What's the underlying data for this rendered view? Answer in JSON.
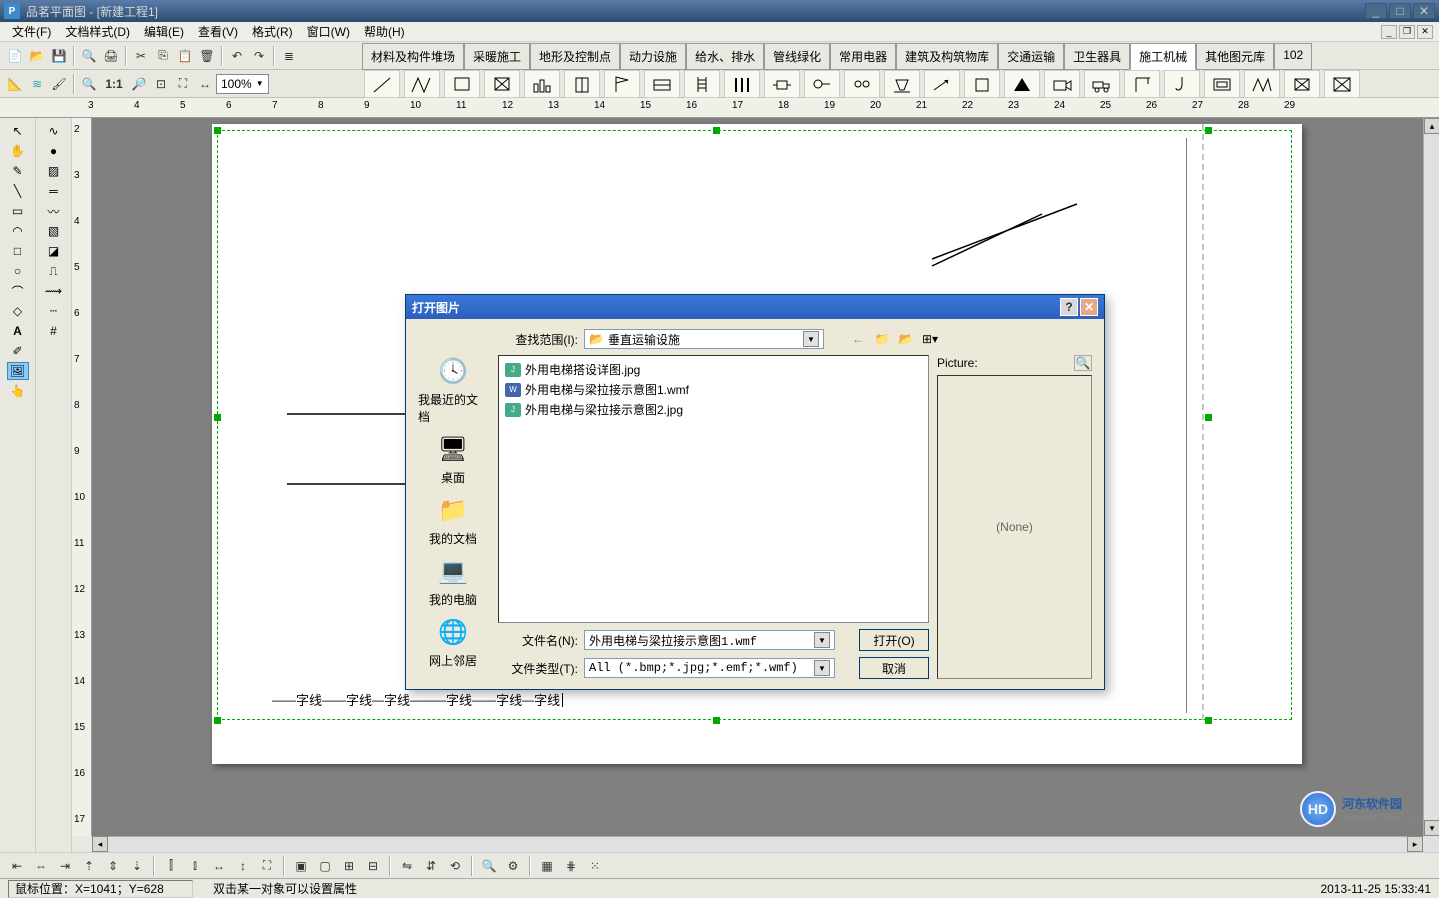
{
  "titlebar": {
    "app_icon_text": "P",
    "title": "品茗平面图 - [新建工程1]"
  },
  "menubar": {
    "items": [
      "文件(F)",
      "文档样式(D)",
      "编辑(E)",
      "查看(V)",
      "格式(R)",
      "窗口(W)",
      "帮助(H)"
    ]
  },
  "zoom": {
    "percent": "100%",
    "label_11": "1:1"
  },
  "tabs": {
    "items": [
      "材料及构件堆场",
      "采暖施工",
      "地形及控制点",
      "动力设施",
      "给水、排水",
      "管线绿化",
      "常用电器",
      "建筑及构筑物库",
      "交通运输",
      "卫生器具",
      "施工机械",
      "其他图元库",
      "102"
    ],
    "active_index": 10
  },
  "ruler_h": {
    "ticks": [
      3,
      4,
      5,
      6,
      7,
      8,
      9,
      10,
      11,
      12,
      13,
      14,
      15,
      16,
      17,
      18,
      19,
      20,
      21,
      22,
      23,
      24,
      25,
      26,
      27,
      28,
      29
    ]
  },
  "ruler_v": {
    "ticks": [
      2,
      3,
      4,
      5,
      6,
      7,
      8,
      9,
      10,
      11,
      12,
      13,
      14,
      15,
      16,
      17
    ]
  },
  "canvas_text": {
    "zixian": "字线"
  },
  "dialog": {
    "title": "打开图片",
    "lookIn_label": "查找范围(I):",
    "lookIn_value": "垂直运输设施",
    "sidebar": [
      "我最近的文档",
      "桌面",
      "我的文档",
      "我的电脑",
      "网上邻居"
    ],
    "files": [
      {
        "name": "外用电梯搭设详图.jpg",
        "ext": "jpg"
      },
      {
        "name": "外用电梯与梁拉接示意图1.wmf",
        "ext": "wmf"
      },
      {
        "name": "外用电梯与梁拉接示意图2.jpg",
        "ext": "jpg"
      }
    ],
    "filename_label": "文件名(N):",
    "filename_value": "外用电梯与梁拉接示意图1.wmf",
    "filetype_label": "文件类型(T):",
    "filetype_value": "All (*.bmp;*.jpg;*.emf;*.wmf)",
    "preview_label": "Picture:",
    "preview_none": "(None)",
    "btn_open": "打开(O)",
    "btn_cancel": "取消"
  },
  "status": {
    "mouse": "鼠标位置：X=1041；Y=628",
    "hint": "双击某一对象可以设置属性",
    "datetime": "2013-11-25  15:33:41"
  },
  "watermark": {
    "circle": "HD",
    "name": "河东软件园",
    "url": "www.pc0359.cn"
  }
}
